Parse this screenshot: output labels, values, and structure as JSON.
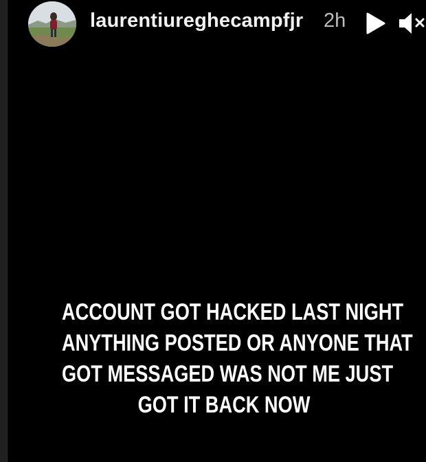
{
  "story": {
    "username": "laurentiureghecampfjr",
    "timestamp": "2h",
    "text_lines": [
      "ACCOUNT GOT HACKED LAST NIGHT",
      "ANYTHING POSTED OR ANYONE THAT",
      "GOT MESSAGED WAS NOT ME JUST",
      "GOT IT BACK NOW"
    ]
  },
  "controls": {
    "play_icon": "play-icon",
    "mute_icon": "volume-muted-icon"
  },
  "colors": {
    "background": "#000000",
    "text": "#ffffff",
    "timestamp": "#bdbdbd"
  }
}
